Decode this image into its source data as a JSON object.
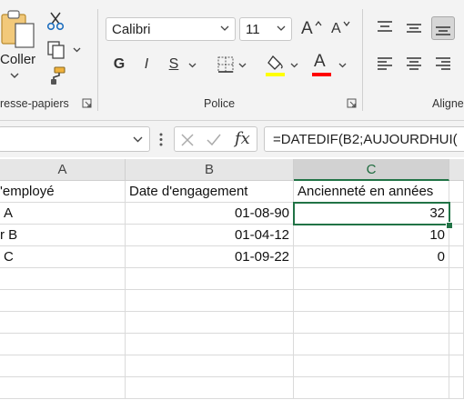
{
  "ribbon": {
    "clipboard": {
      "paste_label": "Coller",
      "group_label": "resse-papiers"
    },
    "font": {
      "font_name": "Calibri",
      "font_size": "11",
      "grow_label": "A",
      "shrink_label": "A",
      "bold_label": "G",
      "italic_label": "I",
      "underline_label": "S",
      "fill_color": "#ffff00",
      "font_color": "#ff0000",
      "font_color_letter": "A",
      "group_label": "Police"
    },
    "alignment": {
      "group_label": "Aligne"
    }
  },
  "formula_bar": {
    "formula": "=DATEDIF(B2;AUJOURDHUI("
  },
  "columns": [
    "A",
    "B",
    "C"
  ],
  "rows": [
    [
      "'employé",
      "Date d'engagement",
      "Ancienneté en années"
    ],
    [
      "A",
      "01-08-90",
      "32"
    ],
    [
      "r B",
      "01-04-12",
      "10"
    ],
    [
      "C",
      "01-09-22",
      "0"
    ]
  ],
  "accent_color": "#217346"
}
